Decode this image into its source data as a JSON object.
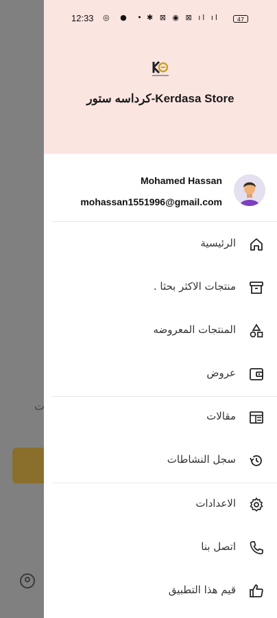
{
  "status_bar": {
    "time": "12:33",
    "left_icons": "◎ ● •",
    "right_icons": "✱ ⊠ ◉ ⊠ ıl ıl",
    "battery": "47"
  },
  "store": {
    "title": "كرداسه ستور-Kerdasa Store",
    "logo_icon": "store-logo-icon"
  },
  "user": {
    "name": "Mohamed Hassan",
    "email": "mohassan1551996@gmail.com"
  },
  "menu": {
    "items": [
      {
        "label": "الرئيسية",
        "icon": "home-icon"
      },
      {
        "label": "منتجات الاكثر بحثا .",
        "icon": "archive-box-icon"
      },
      {
        "label": "المنتجات المعروضه",
        "icon": "shapes-icon"
      },
      {
        "label": "عروض",
        "icon": "wallet-icon"
      },
      {
        "label": "مقالات",
        "icon": "article-icon"
      },
      {
        "label": "سجل النشاطات",
        "icon": "history-icon"
      },
      {
        "label": "الاعدادات",
        "icon": "gear-icon"
      },
      {
        "label": "اتصل بنا",
        "icon": "phone-icon"
      },
      {
        "label": "قيم هذا التطبيق",
        "icon": "thumbs-up-icon"
      }
    ]
  },
  "colors": {
    "header_bg": "#fbe5e1",
    "backdrop": "#808080",
    "accent": "#8a6f2c"
  }
}
